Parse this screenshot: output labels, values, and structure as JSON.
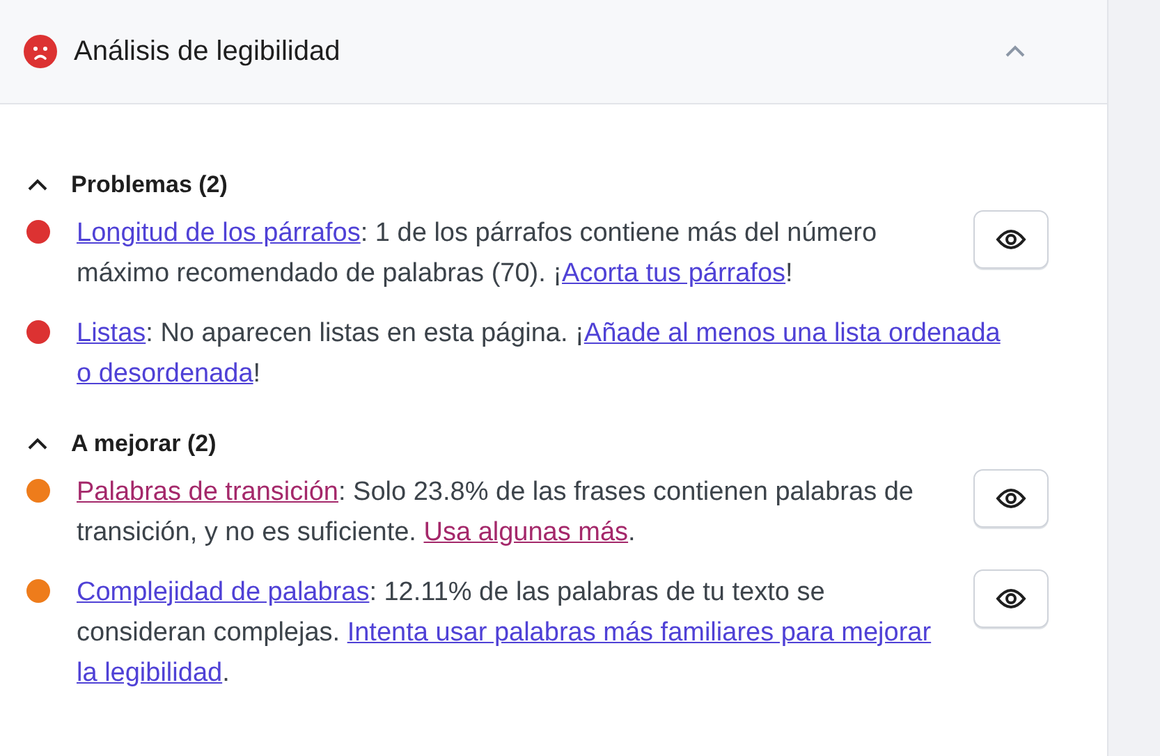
{
  "header": {
    "title": "Análisis de legibilidad",
    "color": "#dc3232",
    "expanded": true
  },
  "sections": [
    {
      "title": "Problemas (2)",
      "expanded": true,
      "items": [
        {
          "color": "#dc3232",
          "highlight": true,
          "parts": [
            {
              "kind": "link",
              "text": "Longitud de los párrafos"
            },
            {
              "kind": "plain",
              "text": ": 1 de los párrafos contiene más del número",
              "break_after": true
            },
            {
              "kind": "plain",
              "text": "máximo recomendado de palabras (70). ¡"
            },
            {
              "kind": "link",
              "text": "Acorta tus párrafos"
            },
            {
              "kind": "plain",
              "text": "!"
            }
          ]
        },
        {
          "color": "#dc3232",
          "highlight": false,
          "parts": [
            {
              "kind": "link",
              "text": "Listas"
            },
            {
              "kind": "plain",
              "text": ": No aparecen listas en esta página. ¡"
            },
            {
              "kind": "link",
              "text": "Añade al menos una lista ordenada",
              "break_after": true
            },
            {
              "kind": "link",
              "text": "o desordenada"
            },
            {
              "kind": "plain",
              "text": "!"
            }
          ]
        }
      ]
    },
    {
      "title": "A mejorar (2)",
      "expanded": true,
      "items": [
        {
          "color": "#ee7c1b",
          "highlight": true,
          "parts": [
            {
              "kind": "visited",
              "text": "Palabras de transición"
            },
            {
              "kind": "plain",
              "text": ": Solo 23.8% de las frases contienen palabras de transición, y no es suficiente. "
            },
            {
              "kind": "visited",
              "text": "Usa algunas más"
            },
            {
              "kind": "plain",
              "text": "."
            }
          ]
        },
        {
          "color": "#ee7c1b",
          "highlight": true,
          "parts": [
            {
              "kind": "link",
              "text": "Complejidad de palabras"
            },
            {
              "kind": "plain",
              "text": ": 12.11% de las palabras de tu texto se",
              "break_after": true
            },
            {
              "kind": "plain",
              "text": "consideran complejas. "
            },
            {
              "kind": "link",
              "text": "Intenta usar palabras más familiares para mejorar",
              "break_after": true
            },
            {
              "kind": "link",
              "text": "la legibilidad"
            },
            {
              "kind": "plain",
              "text": "."
            }
          ]
        }
      ]
    }
  ]
}
